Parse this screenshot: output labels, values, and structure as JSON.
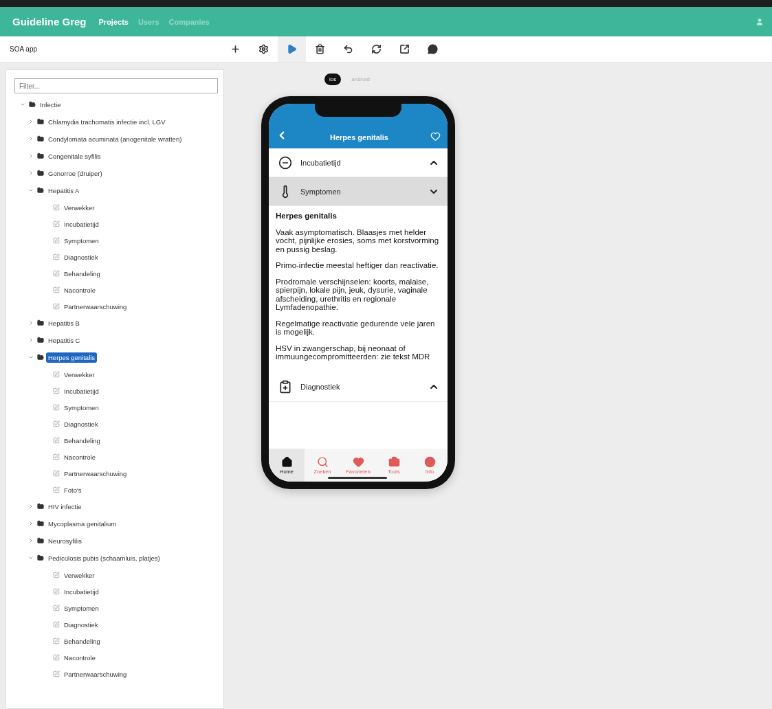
{
  "navbar": {
    "brand": "Guideline Greg",
    "links": [
      {
        "label": "Projects",
        "selected": true
      },
      {
        "label": "Users",
        "selected": false
      },
      {
        "label": "Companies",
        "selected": false
      }
    ]
  },
  "toolbar": {
    "title": "SOA app",
    "actions": [
      {
        "kind": "add",
        "selected": false
      },
      {
        "kind": "settings",
        "selected": false
      },
      {
        "kind": "play",
        "selected": true
      },
      {
        "kind": "delete",
        "selected": false
      },
      {
        "kind": "undo",
        "selected": false
      },
      {
        "kind": "refresh",
        "selected": false
      },
      {
        "kind": "export",
        "selected": false
      },
      {
        "kind": "comment",
        "selected": false
      }
    ]
  },
  "sidebar": {
    "filter": {
      "placeholder": "Filter..."
    },
    "tree": [
      {
        "kind": "folder",
        "label": "Infectie",
        "expanded": true,
        "selected": false,
        "children": [
          {
            "kind": "folder",
            "label": "Chlamydia trachomatis infectie incl. LGV",
            "expanded": false,
            "selected": false
          },
          {
            "kind": "folder",
            "label": "Condylomata acuminata (anogenitale wratten)",
            "expanded": false,
            "selected": false
          },
          {
            "kind": "folder",
            "label": "Congenitale syfilis",
            "expanded": false,
            "selected": false
          },
          {
            "kind": "folder",
            "label": "Gonorroe (druiper)",
            "expanded": false,
            "selected": false
          },
          {
            "kind": "folder",
            "label": "Hepatitis A",
            "expanded": true,
            "selected": false,
            "children": [
              {
                "kind": "leaf",
                "label": "Verwekker",
                "selected": false
              },
              {
                "kind": "leaf",
                "label": "Incubatietijd",
                "selected": false
              },
              {
                "kind": "leaf",
                "label": "Symptomen",
                "selected": false
              },
              {
                "kind": "leaf",
                "label": "Diagnostiek",
                "selected": false
              },
              {
                "kind": "leaf",
                "label": "Behandeling",
                "selected": false
              },
              {
                "kind": "leaf",
                "label": "Nacontrole",
                "selected": false
              },
              {
                "kind": "leaf",
                "label": "Partnerwaarschuwing",
                "selected": false
              }
            ]
          },
          {
            "kind": "folder",
            "label": "Hepatitis B",
            "expanded": false,
            "selected": false
          },
          {
            "kind": "folder",
            "label": "Hepatitis C",
            "expanded": false,
            "selected": false
          },
          {
            "kind": "folder",
            "label": "Herpes genitalis",
            "expanded": true,
            "selected": true,
            "children": [
              {
                "kind": "leaf",
                "label": "Verwekker",
                "selected": false
              },
              {
                "kind": "leaf",
                "label": "Incubatietijd",
                "selected": false
              },
              {
                "kind": "leaf",
                "label": "Symptomen",
                "selected": false
              },
              {
                "kind": "leaf",
                "label": "Diagnostiek",
                "selected": false
              },
              {
                "kind": "leaf",
                "label": "Behandeling",
                "selected": false
              },
              {
                "kind": "leaf",
                "label": "Nacontrole",
                "selected": false
              },
              {
                "kind": "leaf",
                "label": "Partnerwaarschuwing",
                "selected": false
              },
              {
                "kind": "leaf",
                "label": "Foto's",
                "selected": false
              }
            ]
          },
          {
            "kind": "folder",
            "label": "HIV infectie",
            "expanded": false,
            "selected": false
          },
          {
            "kind": "folder",
            "label": "Mycoplasma genitalium",
            "expanded": false,
            "selected": false
          },
          {
            "kind": "folder",
            "label": "Neurosyfilis",
            "expanded": false,
            "selected": false
          },
          {
            "kind": "folder",
            "label": "Pediculosis pubis (schaamluis, platjes)",
            "expanded": true,
            "selected": false,
            "children": [
              {
                "kind": "leaf",
                "label": "Verwekker",
                "selected": false
              },
              {
                "kind": "leaf",
                "label": "Incubatietijd",
                "selected": false
              },
              {
                "kind": "leaf",
                "label": "Symptomen",
                "selected": false
              },
              {
                "kind": "leaf",
                "label": "Diagnostiek",
                "selected": false
              },
              {
                "kind": "leaf",
                "label": "Behandeling",
                "selected": false
              },
              {
                "kind": "leaf",
                "label": "Nacontrole",
                "selected": false
              },
              {
                "kind": "leaf",
                "label": "Partnerwaarschuwing",
                "selected": false
              }
            ]
          }
        ]
      }
    ]
  },
  "preview": {
    "platforms": [
      {
        "label": "ios",
        "selected": true
      },
      {
        "label": "android",
        "selected": false
      }
    ],
    "phone": {
      "title": "Herpes genitalis",
      "sections": [
        {
          "title": "Incubatietijd",
          "kind": "clock",
          "expanded": false
        },
        {
          "title": "Symptomen",
          "kind": "thermometer",
          "expanded": true,
          "heading": "Herpes genitalis",
          "paragraphs": [
            "Vaak asymptomatisch. Blaasjes met helder vocht, pijnlijke erosies, soms met korstvorming en pussig beslag.",
            "Primo-infectie meestal heftiger dan reactivatie.",
            "Prodromale verschijnselen: koorts, malaise, spierpijn, lokale pijn, jeuk, dysurie, vaginale afscheiding, urethritis en regionale Lymfadenopathie.",
            "Regelmatige reactivatie gedurende vele jaren is mogelijk.",
            "HSV in zwangerschap, bij neonaat of immuungecompromitteerden: zie tekst MDR"
          ]
        },
        {
          "title": "Diagnostiek",
          "kind": "clipboard",
          "expanded": false
        }
      ],
      "tabs": [
        {
          "label": "Home",
          "kind": "home",
          "selected": true
        },
        {
          "label": "Zoeken",
          "kind": "search",
          "selected": false
        },
        {
          "label": "Favorieten",
          "kind": "heart",
          "selected": false
        },
        {
          "label": "Tools",
          "kind": "briefcase",
          "selected": false
        },
        {
          "label": "Info",
          "kind": "info",
          "selected": false
        }
      ]
    }
  }
}
